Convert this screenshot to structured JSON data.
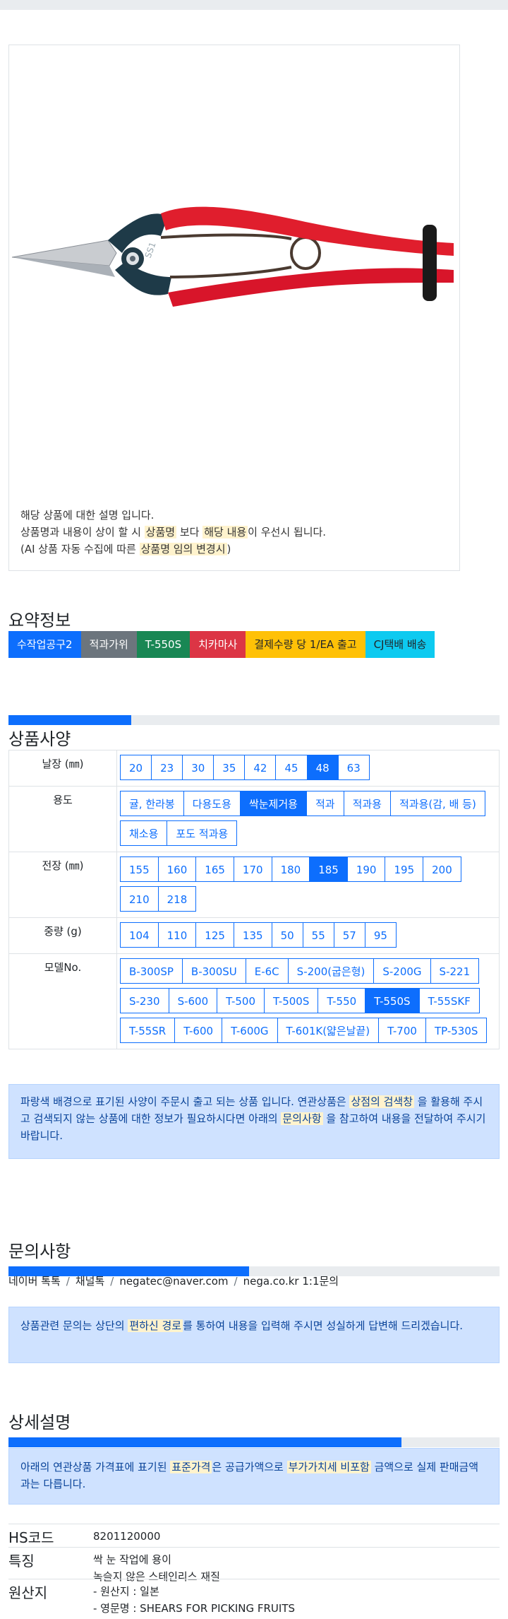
{
  "image_note": {
    "line1": "해당 상품에 대한 설명 입니다.",
    "line2_pre": "상품명과 내용이 상이 할 시 ",
    "line2_hl1": "상품명",
    "line2_mid": " 보다 ",
    "line2_hl2": "해당 내용",
    "line2_post": "이 우선시 됩니다.",
    "line3_pre": "(AI 상품 자동 수집에 따른 ",
    "line3_hl": "상품명 임의 변경시",
    "line3_post": ")",
    "product_engraving": "SS1"
  },
  "summary": {
    "title": "요약정보",
    "badges": [
      {
        "label": "수작업공구2",
        "color": "#0d6efd",
        "text_color": "#ffffff"
      },
      {
        "label": "적과가위",
        "color": "#6c757d",
        "text_color": "#ffffff"
      },
      {
        "label": "T-550S",
        "color": "#198754",
        "text_color": "#ffffff"
      },
      {
        "label": "치카마사",
        "color": "#dc3545",
        "text_color": "#ffffff"
      },
      {
        "label": "결제수량 당 1/EA 출고",
        "color": "#ffc107",
        "text_color": "#212529"
      },
      {
        "label": "CJ택배 배송",
        "color": "#0dcaf0",
        "text_color": "#212529"
      }
    ]
  },
  "spec": {
    "title": "상품사양",
    "progress_fraction": 0.25,
    "rows": [
      {
        "label": "날장 (㎜)",
        "options": [
          "20",
          "23",
          "30",
          "35",
          "42",
          "45",
          "48",
          "63"
        ],
        "selected": "48"
      },
      {
        "label": "용도",
        "options": [
          "귤, 한라봉",
          "다용도용",
          "싹눈제거용",
          "적과",
          "적과용",
          "적과용(감, 배 등)",
          "채소용",
          "포도 적과용"
        ],
        "selected": "싹눈제거용"
      },
      {
        "label": "전장 (㎜)",
        "options": [
          "155",
          "160",
          "165",
          "170",
          "180",
          "185",
          "190",
          "195",
          "200",
          "210",
          "218"
        ],
        "selected": "185"
      },
      {
        "label": "중량 (g)",
        "options": [
          "104",
          "110",
          "125",
          "135",
          "50",
          "55",
          "57",
          "95"
        ],
        "selected": ""
      },
      {
        "label": "모델No.",
        "options": [
          "B-300SP",
          "B-300SU",
          "E-6C",
          "S-200(굽은형)",
          "S-200G",
          "S-221",
          "S-230",
          "S-600",
          "T-500",
          "T-500S",
          "T-550",
          "T-550S",
          "T-55SKF",
          "T-55SR",
          "T-600",
          "T-600G",
          "T-601K(얇은날끝)",
          "T-700",
          "TP-530S"
        ],
        "selected": "T-550S"
      }
    ],
    "notice_pre": "파랑색 배경으로 표기된 사양이 주문시 출고 되는 상품 입니다. 연관상품은 ",
    "notice_hl1": "상점의 검색창",
    "notice_mid": " 을 활용해 주시고 검색되지 않는 상품에 대한 정보가 필요하시다면 아래의 ",
    "notice_hl2": "문의사항",
    "notice_post": " 을 참고하여 내용을 전달하여 주시기 바랍니다."
  },
  "inquiry": {
    "title": "문의사항",
    "progress_fraction": 0.49,
    "contacts": [
      "네이버 톡톡",
      "채널톡",
      "negatec@naver.com",
      "nega.co.kr 1:1문의"
    ],
    "separator": "/",
    "notice_pre": "상품관련 문의는 상단의 ",
    "notice_hl": "편하신 경로",
    "notice_post": "를 통하여 내용을 입력해 주시면 성실하게 답변해 드리겠습니다."
  },
  "detail": {
    "title": "상세설명",
    "progress_fraction": 0.8,
    "notice_pre": "아래의 연관상품 가격표에 표기된 ",
    "notice_hl1": "표준가격",
    "notice_mid": "은 공급가액으로 ",
    "notice_hl2": "부가가치세 비포함",
    "notice_post": " 금액으로 실제 판매금액과는 다릅니다.",
    "info": [
      {
        "key": "HS코드",
        "values": [
          "8201120000"
        ]
      },
      {
        "key": "특징",
        "values": [
          "싹 눈 작업에 용이",
          "녹슬지 않은 스테인리스 재질"
        ]
      },
      {
        "key": "원산지",
        "values": [
          "- 원산지 : 일본",
          "- 영문명 : SHEARS FOR PICKING FRUITS"
        ]
      }
    ]
  }
}
